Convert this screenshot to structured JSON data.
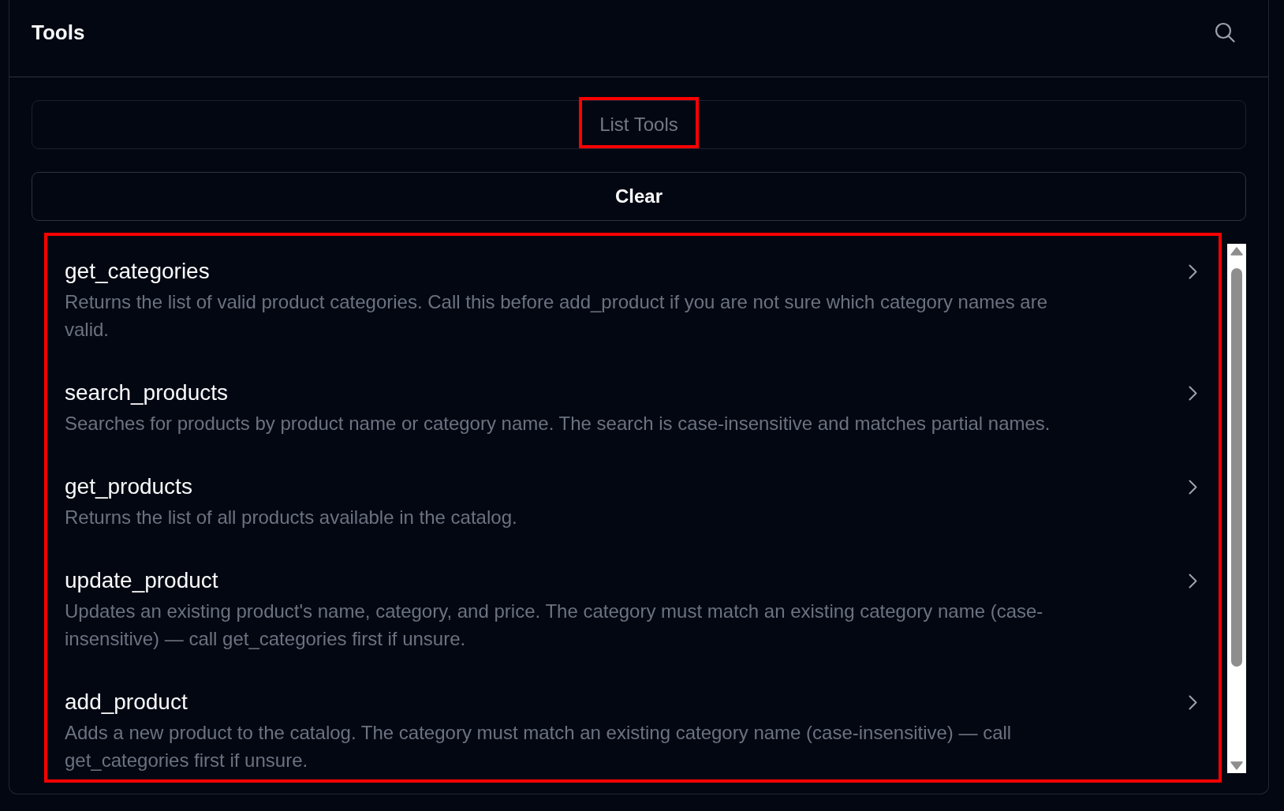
{
  "panel": {
    "title": "Tools"
  },
  "buttons": [
    {
      "label": "List Tools",
      "disabled": true,
      "highlighted": true
    },
    {
      "label": "Clear",
      "disabled": false,
      "highlighted": false
    }
  ],
  "tool_list": {
    "highlighted": true,
    "items": [
      {
        "name": "get_categories",
        "description": "Returns the list of valid product categories. Call this before add_product if you are not sure which category names are valid."
      },
      {
        "name": "search_products",
        "description": "Searches for products by product name or category name. The search is case-insensitive and matches partial names."
      },
      {
        "name": "get_products",
        "description": "Returns the list of all products available in the catalog."
      },
      {
        "name": "update_product",
        "description": "Updates an existing product's name, category, and price. The category must match an existing category name (case-insensitive) — call get_categories first if unsure."
      },
      {
        "name": "add_product",
        "description": "Adds a new product to the catalog. The category must match an existing category name (case-insensitive) — call get_categories first if unsure."
      }
    ]
  }
}
